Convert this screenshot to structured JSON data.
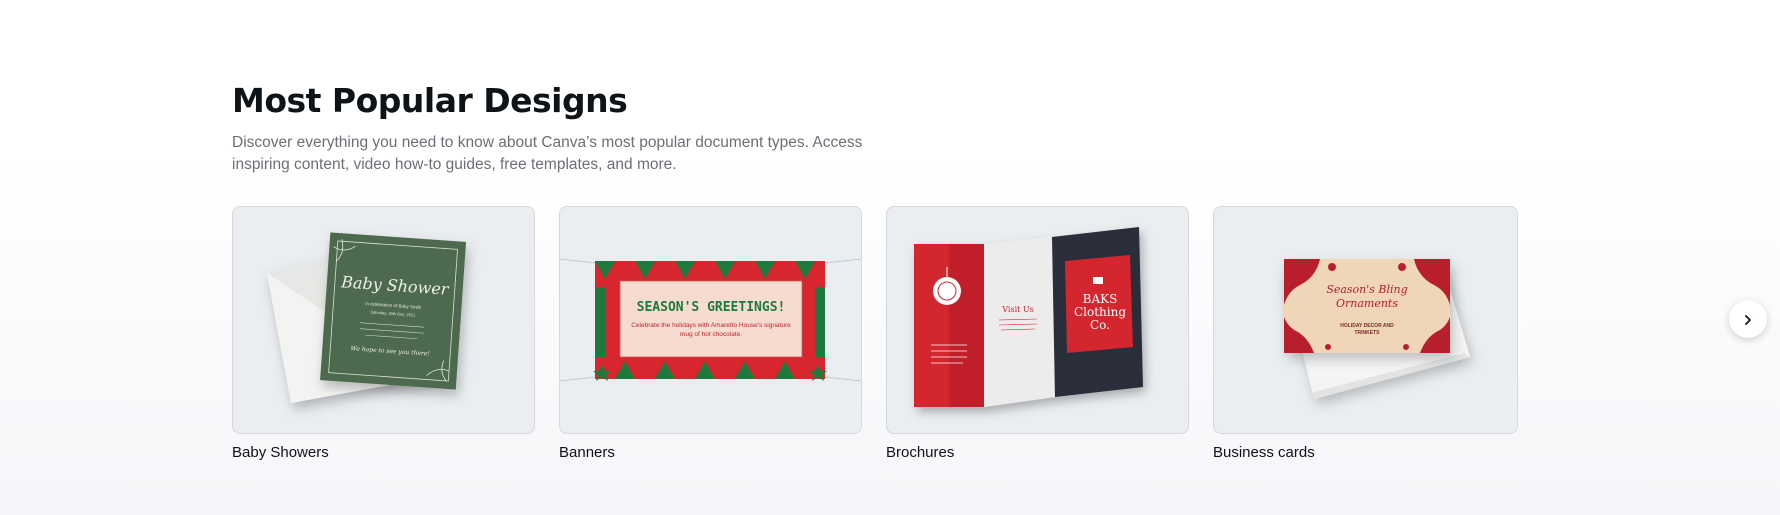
{
  "section": {
    "title": "Most Popular Designs",
    "description": "Discover everything you need to know about Canva’s most popular document types. Access inspiring content, video how-to guides, free templates, and more."
  },
  "cards": [
    {
      "label": "Baby Showers",
      "image": {
        "title": "Baby Shower",
        "line1": "in celebration of Baby Smith",
        "line2": "Saturday, 18th Dec, 2021",
        "closing": "We hope to see you there!"
      }
    },
    {
      "label": "Banners",
      "image": {
        "title": "SEASON'S GREETINGS!",
        "subtitle": "Celebrate the holidays with Amaretto House's signature mug of hot chocolate."
      }
    },
    {
      "label": "Brochures",
      "image": {
        "visit": "Visit Us",
        "brand": "BAKS Clothing Co."
      }
    },
    {
      "label": "Business cards",
      "image": {
        "title": "Season's Bling Ornaments",
        "subtitle": "HOLIDAY DECOR AND TRINKETS"
      }
    }
  ],
  "icons": {
    "next": "chevron-right-icon"
  },
  "colors": {
    "thumb_bg": "#ebeef1",
    "baby_card": "#4d6b50",
    "banner_red": "#d8262f",
    "banner_green": "#1e7a3c",
    "brochure_red": "#d3262f",
    "bizcard_red": "#b81f2b",
    "bizcard_cream": "#efd6b7"
  }
}
